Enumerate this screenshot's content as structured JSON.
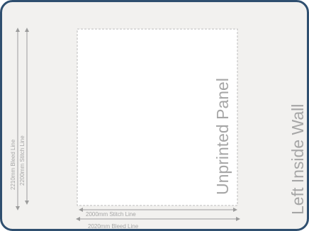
{
  "wall_label": "Left Inside Wall",
  "panel_label": "Unprinted Panel",
  "dimensions": {
    "bleed_height": "2210mm Bleed Line",
    "stitch_height": "2200mm Stitch Line",
    "stitch_width": "2000mm Stitch Line",
    "bleed_width": "2020mm Bleed Line"
  },
  "colors": {
    "frame_stroke": "#2f4f6f",
    "frame_fill": "#f2f1ef",
    "panel_fill": "#ffffff",
    "panel_border": "#bdbdbd",
    "text": "#a6a6a6",
    "arrow": "#9c9c9c"
  }
}
